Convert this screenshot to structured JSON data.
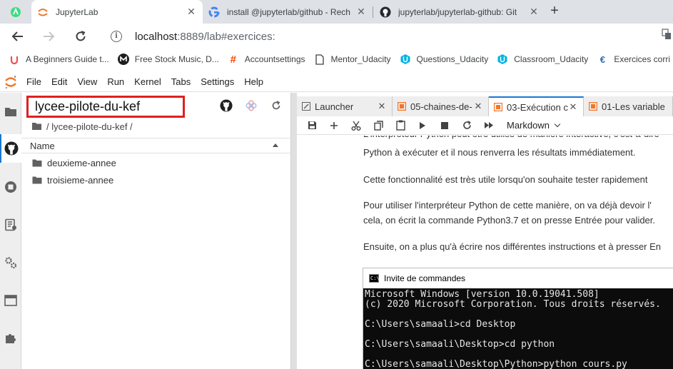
{
  "browser": {
    "tabs": [
      {
        "title": "JupyterLab",
        "active": true
      },
      {
        "title": "install @jupyterlab/github - Rech"
      },
      {
        "title": "jupyterlab/jupyterlab-github: Git"
      }
    ],
    "new_tab": "+",
    "close_glyph": "✕",
    "url_host": "localhost",
    "url_path": ":8889/lab#exercices:",
    "bookmarks": [
      "A Beginners Guide t...",
      "Free Stock Music, D...",
      "Accountsettings",
      "Mentor_Udacity",
      "Questions_Udacity",
      "Classroom_Udacity",
      "Exercices corri"
    ]
  },
  "jupyter": {
    "menu": [
      "File",
      "Edit",
      "View",
      "Run",
      "Kernel",
      "Tabs",
      "Settings",
      "Help"
    ],
    "file_panel": {
      "repo_input": "lycee-pilote-du-kef",
      "breadcrumb": "/ lycee-pilote-du-kef /",
      "column_name": "Name",
      "items": [
        {
          "name": "deuxieme-annee"
        },
        {
          "name": "troisieme-annee"
        }
      ]
    },
    "doc_tabs": [
      {
        "title": "Launcher"
      },
      {
        "title": "05-chaines-de-"
      },
      {
        "title": "03-Exécution c",
        "active": true
      },
      {
        "title": "01-Les variable"
      }
    ],
    "cell_type": "Markdown",
    "notebook": {
      "paragraphs": [
        "L'interpréteur Python peut être utilisé de manière interactive, c'est-à-dire",
        "Python à exécuter et il nous renverra les résultats immédiatement.",
        "Cette fonctionnalité est très utile lorsqu'on souhaite tester rapidement",
        "Pour utiliser l'interpréteur Python de cette manière, on va déjà devoir l'",
        "cela, on écrit la commande Python3.7 et on presse Entrée pour valider.",
        "Ensuite, on a plus qu'à écrire nos différentes instructions et à presser En"
      ],
      "cmd_title": "Invite de commandes",
      "cmd_icon_text": "C:\\",
      "cmd_lines": [
        "Microsoft Windows [version 10.0.19041.508]",
        "(c) 2020 Microsoft Corporation. Tous droits réservés.",
        "C:\\Users\\samaali>cd Desktop",
        "C:\\Users\\samaali\\Desktop>cd python",
        "C:\\Users\\samaali\\Desktop\\Python>python cours.py"
      ]
    }
  },
  "colors": {
    "highlight_border": "#e02020",
    "accent": "#1976d2",
    "jupyter_orange": "#f37626"
  }
}
